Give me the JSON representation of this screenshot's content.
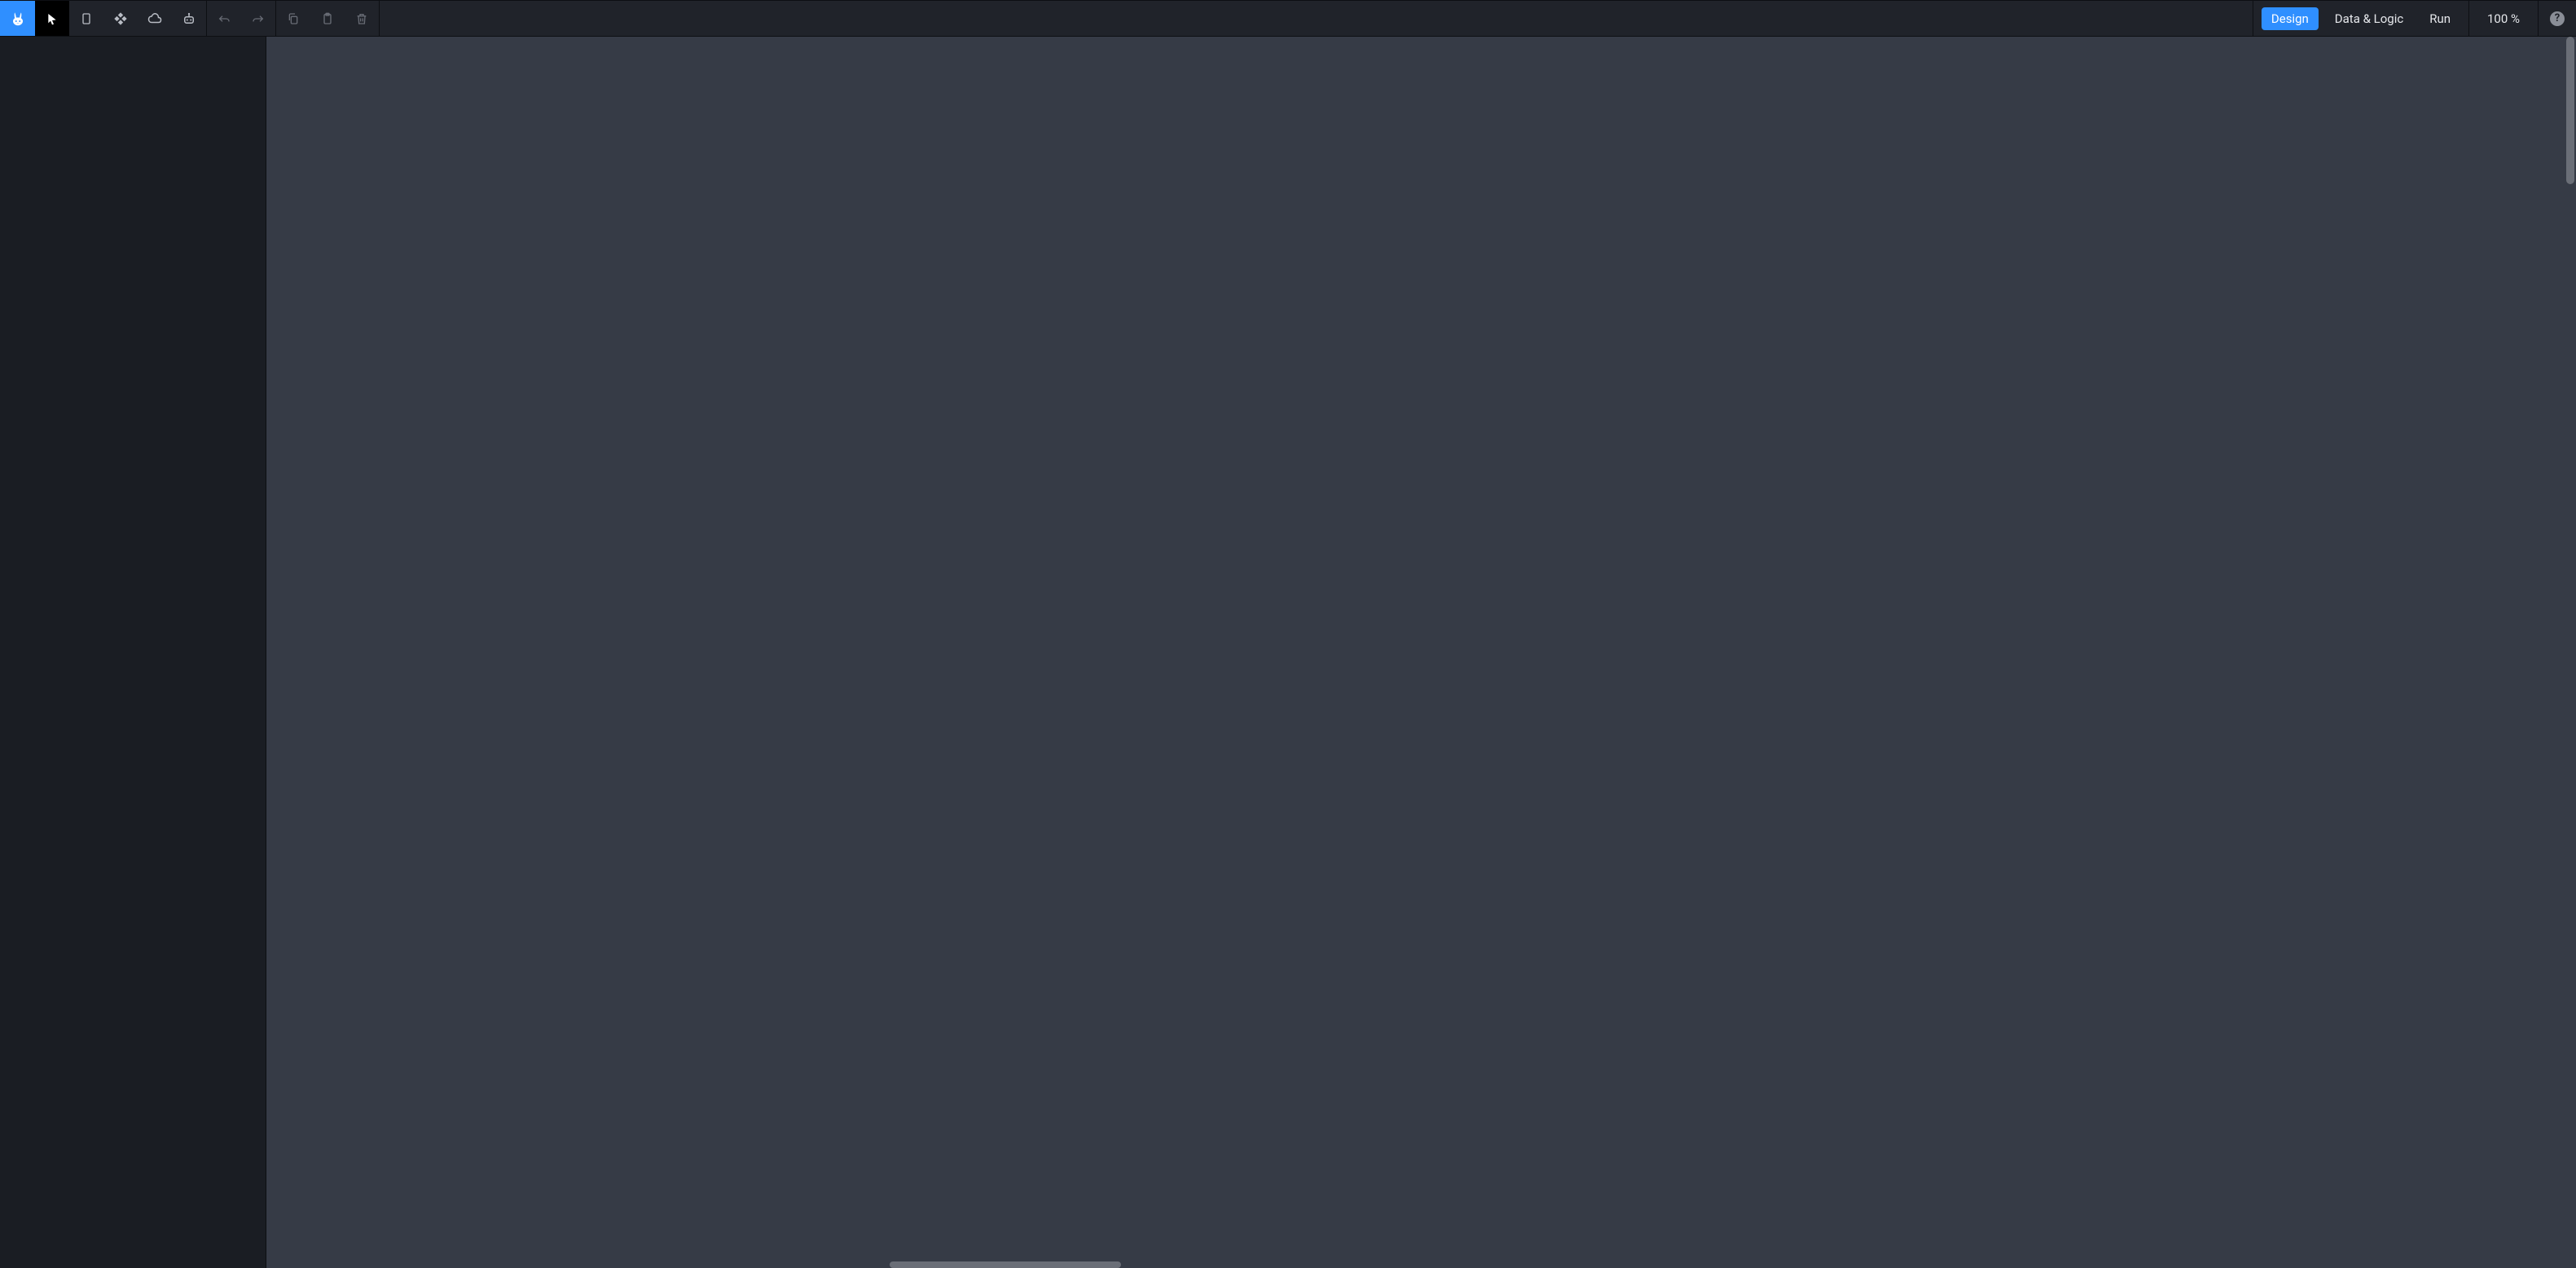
{
  "modes": {
    "design": "Design",
    "data_logic": "Data & Logic",
    "run": "Run",
    "active": "design"
  },
  "zoom": "100 %",
  "help_glyph": "?"
}
